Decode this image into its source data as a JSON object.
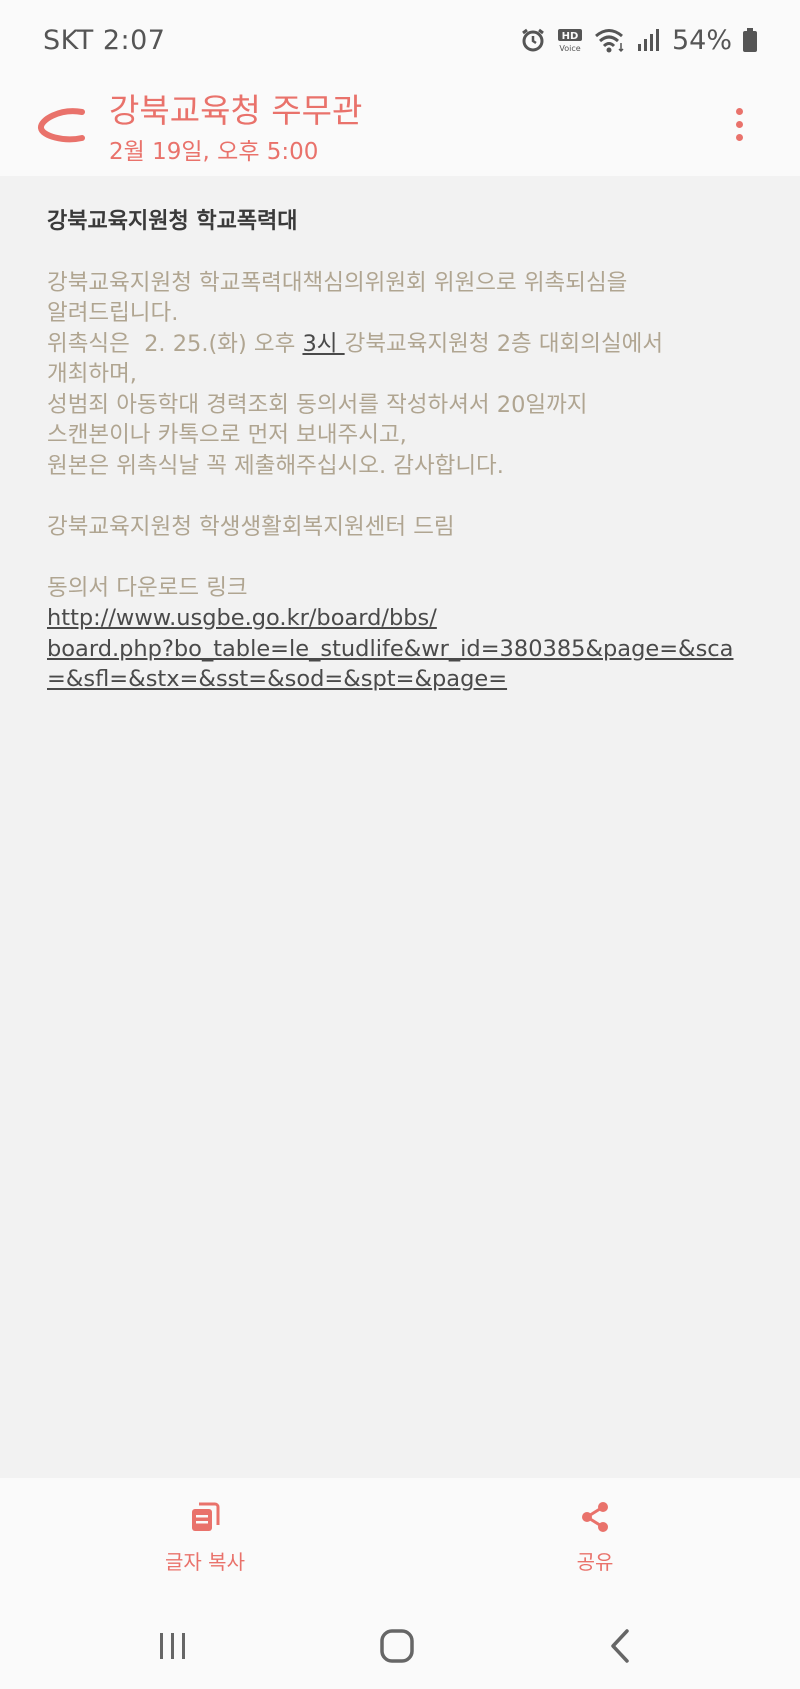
{
  "status_bar": {
    "carrier_time": "SKT 2:07",
    "battery": "54%",
    "icons": [
      "alarm-icon",
      "hd-voice-icon",
      "wifi-icon",
      "signal-icon",
      "battery-icon"
    ]
  },
  "header": {
    "sender": "강북교육청 주무관",
    "date": "2월 19일, 오후 5:00",
    "accent_color": "#e9726b"
  },
  "message": {
    "subject": "강북교육지원청 학교폭력대",
    "line1": "강북교육지원청 학교폭력대책심의위원회 위원으로 위촉되심을",
    "line2": "알려드립니다.",
    "line3_prefix": "위촉식은  2. 25.(화) 오후 ",
    "line3_underlined": "3시 ",
    "line3_suffix": "강북교육지원청 2층 대회의실에서",
    "line4": "개최하며,",
    "line5": "성범죄 아동학대 경력조회 동의서를 작성하셔서 20일까지",
    "line6": "스캔본이나 카톡으로 먼저 보내주시고,",
    "line7": "원본은 위촉식날 꼭 제출해주십시오. 감사합니다.",
    "signature": "강북교육지원청 학생생활회복지원센터 드림",
    "link_label": "동의서 다운로드 링크",
    "link_line1": "http://www.usgbe.go.kr/board/bbs/",
    "link_line2": "board.php?bo_table=le_studlife&wr_id=380385&page=&sca",
    "link_line3": "=&sfl=&stx=&sst=&sod=&spt=&page="
  },
  "actions": {
    "copy_label": "글자 복사",
    "share_label": "공유"
  }
}
